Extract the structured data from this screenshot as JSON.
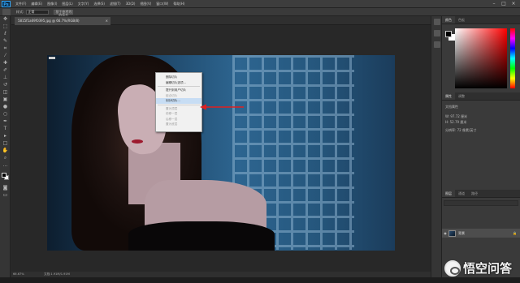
{
  "app": {
    "logo": "Ps"
  },
  "menubar": {
    "items": [
      "文件(F)",
      "编辑(E)",
      "图像(I)",
      "图层(L)",
      "文字(Y)",
      "选择(S)",
      "滤镜(T)",
      "3D(D)",
      "视图(V)",
      "窗口(W)",
      "帮助(H)"
    ],
    "window_controls": [
      "minimize-icon",
      "maximize-icon",
      "close-icon"
    ]
  },
  "options": {
    "style_label": "样式:",
    "style_value": "正常",
    "button_label": "基于参考线的切片"
  },
  "document": {
    "tab_title": "5815f1a69f0395.jpg @ 66.7%(RGB/8)",
    "zoom": "66.67%",
    "doc_info": "文档:1.91M/1.91M"
  },
  "context_menu": {
    "items": [
      {
        "label": "删除切片",
        "disabled": false
      },
      {
        "label": "编辑切片选项...",
        "disabled": false
      },
      {
        "separator": true
      },
      {
        "label": "提升到用户切片",
        "disabled": false
      },
      {
        "label": "组合切片",
        "disabled": true
      },
      {
        "label": "划分切片...",
        "disabled": false,
        "highlighted": true
      },
      {
        "separator": true
      },
      {
        "label": "置为顶层",
        "disabled": true
      },
      {
        "label": "前移一层",
        "disabled": true
      },
      {
        "label": "后移一层",
        "disabled": true
      },
      {
        "label": "置为底层",
        "disabled": true
      }
    ],
    "arrow_color": "#e02020"
  },
  "panels": {
    "color_tabs": [
      "颜色",
      "色板"
    ],
    "props_tabs": [
      "属性",
      "调整"
    ],
    "props_doc": "文档属性",
    "props_size": "W: 97.72 厘米",
    "props_height": "H: 52.79 厘米",
    "props_res": "分辨率: 72 像素/英寸",
    "layers_tabs": [
      "图层",
      "通道",
      "路径"
    ],
    "layer_name": "背景"
  },
  "watermark": {
    "text": "悟空问答"
  }
}
